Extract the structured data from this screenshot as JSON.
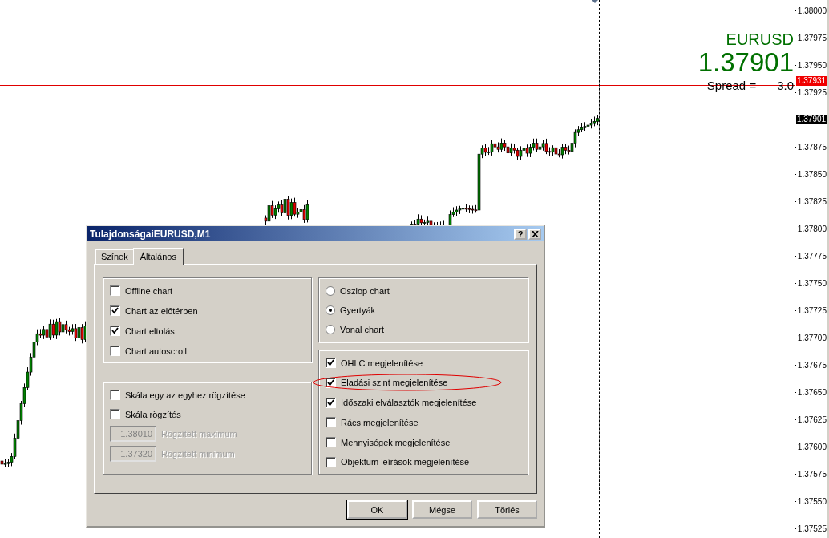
{
  "chart": {
    "symbol": "EURUSD",
    "bid": "1.37901",
    "spread_label": "Spread =",
    "spread_value": "3.0",
    "ask_marker": "1.37931",
    "bid_marker": "1.37901",
    "price_axis": [
      "1.38000",
      "1.37975",
      "1.37950",
      "1.37925",
      "1.37875",
      "1.37850",
      "1.37825",
      "1.37800",
      "1.37775",
      "1.37750",
      "1.37725",
      "1.37700",
      "1.37675",
      "1.37650",
      "1.37625",
      "1.37600",
      "1.37575",
      "1.37550",
      "1.37525"
    ]
  },
  "dialog": {
    "title": "TulajdonságaiEURUSD,M1",
    "help_button": "?",
    "tabs": [
      {
        "label": "Színek",
        "selected": false
      },
      {
        "label": "Általános",
        "selected": true
      }
    ],
    "general_options": [
      {
        "label": "Offline chart",
        "checked": false
      },
      {
        "label": "Chart az előtérben",
        "checked": true
      },
      {
        "label": "Chart eltolás",
        "checked": true
      },
      {
        "label": "Chart autoscroll",
        "checked": false
      }
    ],
    "scale_options": [
      {
        "label": "Skála egy az egyhez rögzítése",
        "checked": false
      },
      {
        "label": "Skála rögzítés",
        "checked": false
      }
    ],
    "fixed_fields": [
      {
        "value": "1.38010",
        "label": "Rögzített maximum",
        "disabled": true
      },
      {
        "value": "1.37320",
        "label": "Rögzített minimum",
        "disabled": true
      }
    ],
    "chart_types": [
      {
        "label": "Oszlop chart",
        "selected": false
      },
      {
        "label": "Gyertyák",
        "selected": true
      },
      {
        "label": "Vonal chart",
        "selected": false
      }
    ],
    "display_options": [
      {
        "label": "OHLC megjelenítése",
        "checked": true,
        "highlighted": false
      },
      {
        "label": "Eladási szint megjelenítése",
        "checked": true,
        "highlighted": true
      },
      {
        "label": "Időszaki elválasztók megjelenítése",
        "checked": true,
        "highlighted": false
      },
      {
        "label": "Rács megjelenítése",
        "checked": false,
        "highlighted": false
      },
      {
        "label": "Mennyiségek megjelenítése",
        "checked": false,
        "highlighted": false
      },
      {
        "label": "Objektum leírások megjelenítése",
        "checked": false,
        "highlighted": false
      }
    ],
    "buttons": [
      {
        "label": "OK",
        "default": true
      },
      {
        "label": "Mégse",
        "default": false
      },
      {
        "label": "Törlés",
        "default": false
      }
    ]
  }
}
